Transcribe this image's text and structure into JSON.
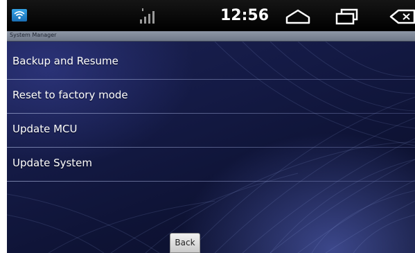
{
  "status_bar": {
    "time": "12:56",
    "icons": [
      "wifi-icon",
      "signal-icon",
      "home-icon",
      "recent-apps-icon",
      "back-icon"
    ],
    "accent_color": "#2a8fd6"
  },
  "title_bar": {
    "title": "System Manager"
  },
  "menu": {
    "items": [
      {
        "label": "Backup and Resume"
      },
      {
        "label": "Reset to factory mode"
      },
      {
        "label": "Update MCU"
      },
      {
        "label": "Update System"
      }
    ]
  },
  "footer": {
    "back_label": "Back"
  }
}
